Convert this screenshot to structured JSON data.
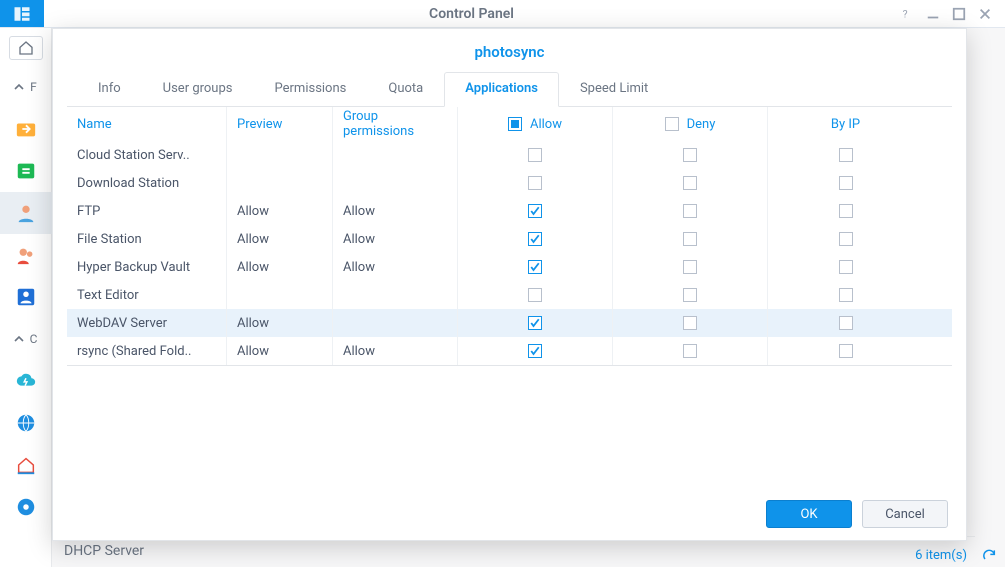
{
  "window": {
    "title": "Control Panel",
    "min_label": "minimize",
    "max_label": "maximize",
    "close_label": "close",
    "help_label": "help"
  },
  "dialog": {
    "title": "photosync",
    "ok_label": "OK",
    "cancel_label": "Cancel"
  },
  "tabs": [
    {
      "label": "Info",
      "active": false
    },
    {
      "label": "User groups",
      "active": false
    },
    {
      "label": "Permissions",
      "active": false
    },
    {
      "label": "Quota",
      "active": false
    },
    {
      "label": "Applications",
      "active": true
    },
    {
      "label": "Speed Limit",
      "active": false
    }
  ],
  "columns": {
    "name": "Name",
    "preview": "Preview",
    "group_permissions": "Group permissions",
    "allow": "Allow",
    "deny": "Deny",
    "by_ip": "By IP"
  },
  "rows": [
    {
      "name": "Cloud Station Serv..",
      "preview": "",
      "gperm": "",
      "allow": false,
      "deny": false,
      "byip": false,
      "selected": false
    },
    {
      "name": "Download Station",
      "preview": "",
      "gperm": "",
      "allow": false,
      "deny": false,
      "byip": false,
      "selected": false
    },
    {
      "name": "FTP",
      "preview": "Allow",
      "gperm": "Allow",
      "allow": true,
      "deny": false,
      "byip": false,
      "selected": false
    },
    {
      "name": "File Station",
      "preview": "Allow",
      "gperm": "Allow",
      "allow": true,
      "deny": false,
      "byip": false,
      "selected": false
    },
    {
      "name": "Hyper Backup Vault",
      "preview": "Allow",
      "gperm": "Allow",
      "allow": true,
      "deny": false,
      "byip": false,
      "selected": false
    },
    {
      "name": "Text Editor",
      "preview": "",
      "gperm": "",
      "allow": false,
      "deny": false,
      "byip": false,
      "selected": false
    },
    {
      "name": "WebDAV Server",
      "preview": "Allow",
      "gperm": "",
      "allow": true,
      "deny": false,
      "byip": false,
      "selected": true
    },
    {
      "name": "rsync (Shared Fold..",
      "preview": "Allow",
      "gperm": "Allow",
      "allow": true,
      "deny": false,
      "byip": false,
      "selected": false
    }
  ],
  "left_nav": {
    "section_letter_top": "F",
    "section_letter_mid": "C",
    "dhcp_label": "DHCP Server"
  },
  "status": {
    "items_text": "6 item(s)"
  }
}
